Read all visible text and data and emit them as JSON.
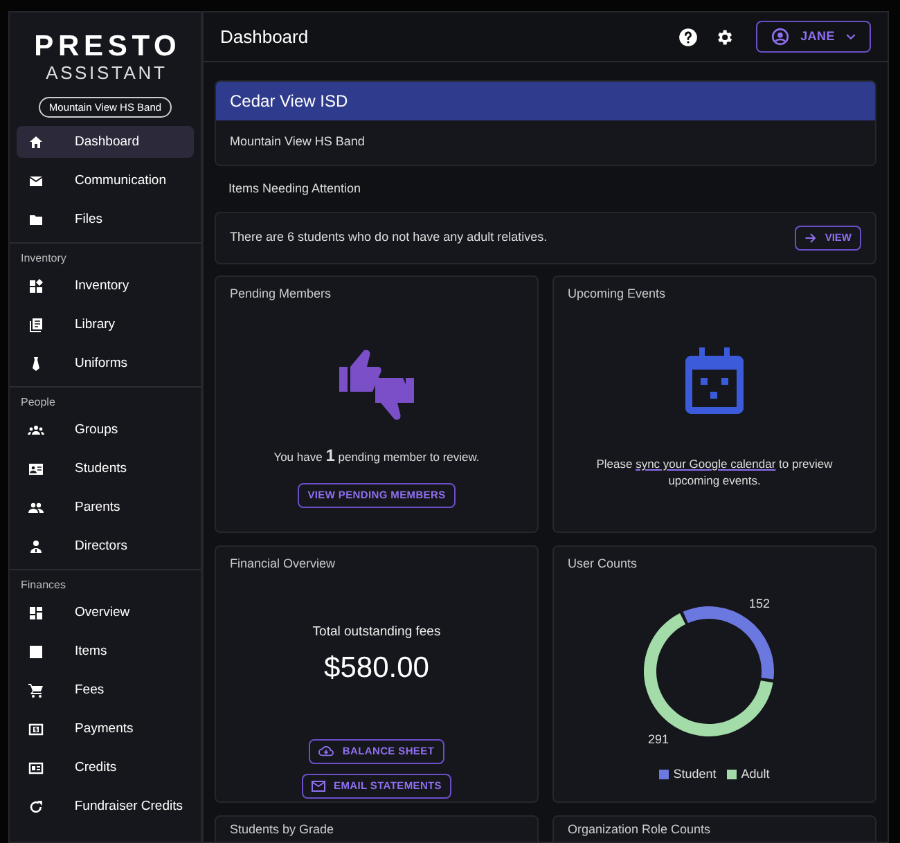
{
  "logo": {
    "line_1": "PRESTO",
    "line_2": "ASSISTANT"
  },
  "organization_badge": "Mountain View HS Band",
  "sidebar": {
    "sections": [
      {
        "items": [
          {
            "label": "Dashboard",
            "selected": true
          },
          {
            "label": "Communication",
            "selected": false
          },
          {
            "label": "Files",
            "selected": false
          }
        ]
      },
      {
        "heading": "Inventory",
        "items": [
          {
            "label": "Inventory",
            "selected": false
          },
          {
            "label": "Library",
            "selected": false
          },
          {
            "label": "Uniforms",
            "selected": false
          }
        ]
      },
      {
        "heading": "People",
        "items": [
          {
            "label": "Groups",
            "selected": false
          },
          {
            "label": "Students",
            "selected": false
          },
          {
            "label": "Parents",
            "selected": false
          },
          {
            "label": "Directors",
            "selected": false
          }
        ]
      },
      {
        "heading": "Finances",
        "items": [
          {
            "label": "Overview",
            "selected": false
          },
          {
            "label": "Items",
            "selected": false
          },
          {
            "label": "Fees",
            "selected": false
          },
          {
            "label": "Payments",
            "selected": false
          },
          {
            "label": "Credits",
            "selected": false
          },
          {
            "label": "Fundraiser Credits",
            "selected": false
          }
        ]
      }
    ]
  },
  "header": {
    "title": "Dashboard",
    "user_button": "JANE"
  },
  "district_card": {
    "title": "Cedar View ISD",
    "subtitle": "Mountain View HS Band"
  },
  "attention": {
    "heading": "Items Needing Attention",
    "items": [
      {
        "text": "There are 6 students who do not have any adult relatives.",
        "button": "VIEW"
      }
    ]
  },
  "pending_members": {
    "title": "Pending Members",
    "message": "You have **1** pending member to review.",
    "button": "VIEW PENDING MEMBERS"
  },
  "upcoming_events": {
    "title": "Upcoming Events",
    "message_before": "Please",
    "link": "sync your Google calendar",
    "message_after": "to preview upcoming events."
  },
  "financial_overview": {
    "title": "Financial Overview",
    "label": "Total outstanding fees",
    "amount": "$580.00",
    "buttons": [
      "BALANCE SHEET",
      "EMAIL STATEMENTS"
    ]
  },
  "user_counts": {
    "title": "User Counts",
    "chart_data": {
      "type": "donut",
      "categories": [
        "Student",
        "Adult"
      ],
      "values": [
        152,
        291
      ],
      "colors": [
        "#6b78e0",
        "#a3dca8"
      ],
      "data_labels": true
    }
  },
  "bottom_cards": [
    {
      "title": "Students by Grade"
    },
    {
      "title": "Organization Role Counts"
    }
  ]
}
